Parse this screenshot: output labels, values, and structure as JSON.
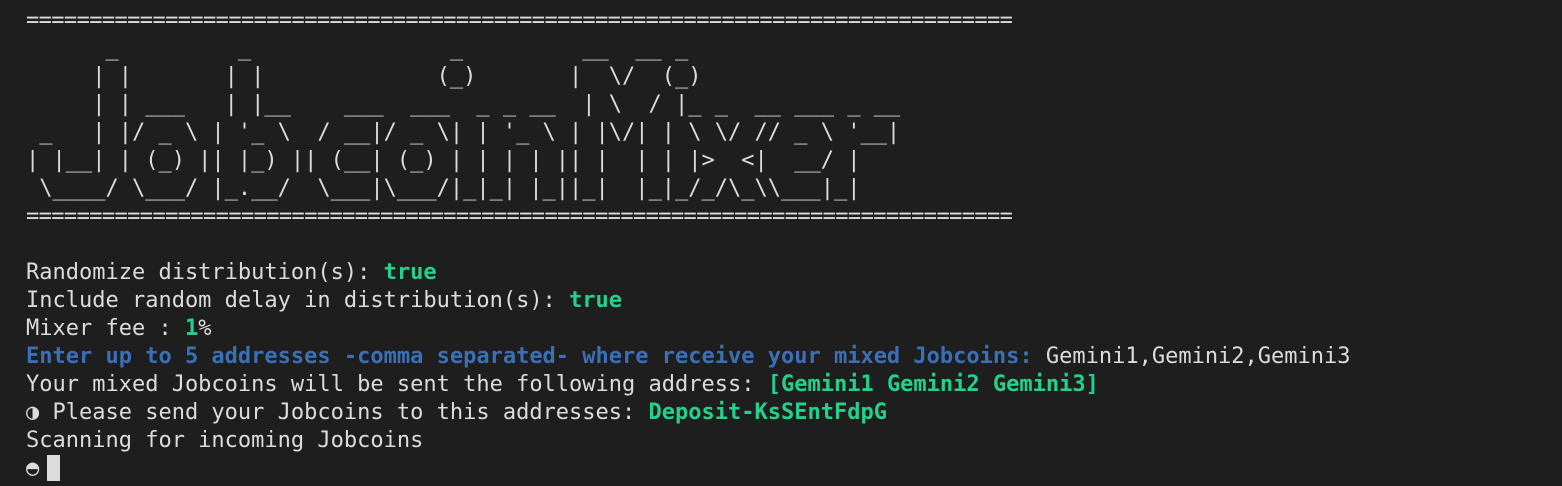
{
  "banner": {
    "rule": "==============================================================================",
    "ascii_art": "      _         _               _         __  __ _              \n     | |       | |             (_)       |  \\/  (_)             \n     | | ___   | |__    ___  ___  _ _ __  | \\  / |_ _  __ ___ _ __ \n _   | |/ _ \\ | '_ \\  / __|/ _ \\| | '_ \\ | |\\/| | \\ \\/ // _ \\ '__|\n| |__| | (_) || |_) || (__| (_) | | | | || |  | | |>  <|  __/ |   \n \\____/ \\___/ |_.__/  \\___|\\___/|_|_| |_||_|  |_|_/_/\\_\\\\___|_|   "
  },
  "settings": {
    "randomize_label": "Randomize distribution(s): ",
    "randomize_value": "true",
    "delay_label": "Include random delay in distribution(s): ",
    "delay_value": "true",
    "fee_label": "Mixer fee : ",
    "fee_value": "1",
    "fee_unit": "%"
  },
  "prompt": {
    "text": "Enter up to 5 addresses -comma separated- where receive your mixed Jobcoins: ",
    "input": "Gemini1,Gemini2,Gemini3"
  },
  "result": {
    "sent_label": "Your mixed Jobcoins will be sent the following address: ",
    "sent_value": "[Gemini1 Gemini2 Gemini3]",
    "deposit_icon": "◑",
    "deposit_label": " Please send your Jobcoins to this addresses: ",
    "deposit_value": "Deposit-KsSEntFdpG",
    "scanning": "Scanning for incoming Jobcoins",
    "spinner_icon": "◓"
  },
  "colors": {
    "background": "#1e1e1e",
    "foreground": "#dcdcdc",
    "value_green": "#23d18b",
    "prompt_blue": "#3b6fb6"
  }
}
